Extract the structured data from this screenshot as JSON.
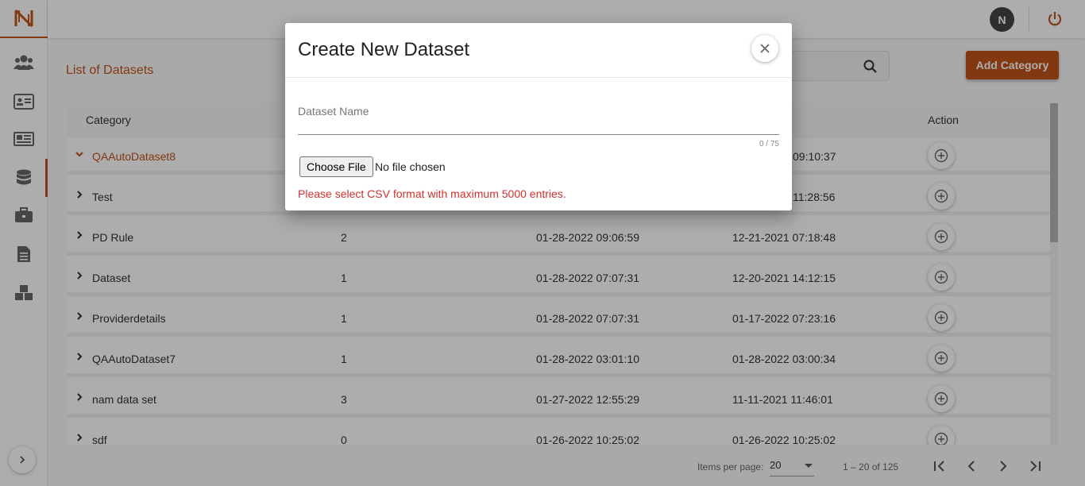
{
  "colors": {
    "accent": "#c0531a",
    "error": "#d32f2f"
  },
  "sidebar": {
    "logo_icon": "brand-logo-n",
    "items": [
      {
        "name": "users-icon"
      },
      {
        "name": "id-card-icon"
      },
      {
        "name": "newspaper-icon"
      },
      {
        "name": "database-icon",
        "active": true
      },
      {
        "name": "briefcase-icon"
      },
      {
        "name": "document-icon"
      },
      {
        "name": "cubes-icon"
      }
    ],
    "expand_icon": "chevron-right-icon"
  },
  "topbar": {
    "avatar_initial": "N",
    "power_icon": "power-icon"
  },
  "main": {
    "title": "List of Datasets",
    "add_category_label": "Add Category",
    "search_icon": "search-icon"
  },
  "table": {
    "headers": {
      "category": "Category",
      "action": "Action"
    },
    "rows": [
      {
        "category": "QAAutoDataset8",
        "count": "",
        "updated": "",
        "created": "09:10:37",
        "expanded": true
      },
      {
        "category": "Test",
        "count": "",
        "updated": "",
        "created": "11:28:56"
      },
      {
        "category": "PD Rule",
        "count": "2",
        "updated": "01-28-2022 09:06:59",
        "created": "12-21-2021 07:18:48"
      },
      {
        "category": "Dataset",
        "count": "1",
        "updated": "01-28-2022 07:07:31",
        "created": "12-20-2021 14:12:15"
      },
      {
        "category": "Providerdetails",
        "count": "1",
        "updated": "01-28-2022 07:07:31",
        "created": "01-17-2022 07:23:16"
      },
      {
        "category": "QAAutoDataset7",
        "count": "1",
        "updated": "01-28-2022 03:01:10",
        "created": "01-28-2022 03:00:34"
      },
      {
        "category": "nam data set",
        "count": "3",
        "updated": "01-27-2022 12:55:29",
        "created": "11-11-2021 11:46:01"
      },
      {
        "category": "sdf",
        "count": "0",
        "updated": "01-26-2022 10:25:02",
        "created": "01-26-2022 10:25:02"
      }
    ]
  },
  "paginator": {
    "items_per_page_label": "Items per page:",
    "items_per_page": "20",
    "range": "1 – 20 of 125"
  },
  "dialog": {
    "title": "Create New Dataset",
    "name_label": "Dataset Name",
    "name_value": "",
    "counter": "0 / 75",
    "choose_file_label": "Choose File",
    "file_status": "No file chosen",
    "hint": "Please select CSV format with maximum 5000 entries."
  }
}
